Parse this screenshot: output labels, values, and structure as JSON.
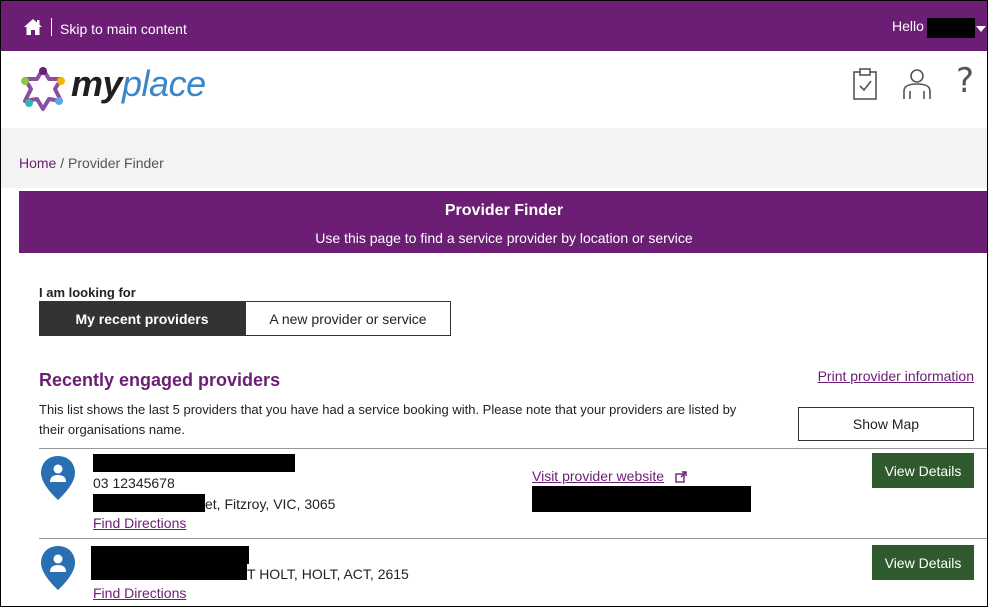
{
  "topbar": {
    "skip_label": "Skip to main content",
    "hello_label": "Hello"
  },
  "header": {
    "logo_my": "my",
    "logo_place": "place",
    "help_glyph": "?"
  },
  "breadcrumb": {
    "home": "Home",
    "separator": "/",
    "current": "Provider Finder"
  },
  "banner": {
    "title": "Provider Finder",
    "subtitle": "Use this page to find a service provider by location or service"
  },
  "looking_for": {
    "label": "I am looking for",
    "options": [
      "My recent providers",
      "A new provider or service"
    ],
    "selected": "My recent providers"
  },
  "recent": {
    "title": "Recently engaged providers",
    "print_link": "Print provider information",
    "description": "This list shows the last 5 providers that you have had a service booking with. Please note that your providers are listed by their organisations name.",
    "show_map_label": "Show Map"
  },
  "providers": [
    {
      "phone": "03 12345678",
      "address_partial": "et, Fitzroy, VIC, 3065",
      "directions_label": "Find Directions",
      "website_label": "Visit provider website",
      "view_label": "View Details"
    },
    {
      "address_partial": "T HOLT, HOLT, ACT, 2615",
      "directions_label": "Find Directions",
      "view_label": "View Details"
    }
  ],
  "colors": {
    "brand_purple": "#6b1e74",
    "logo_blue": "#3a86c6",
    "view_button_green": "#2e5a2e",
    "pin_blue": "#2b6fb3"
  },
  "icons": [
    "home-icon",
    "myplace-logo-icon",
    "clipboard-icon",
    "person-icon",
    "help-icon",
    "location-pin-icon",
    "external-link-icon"
  ]
}
